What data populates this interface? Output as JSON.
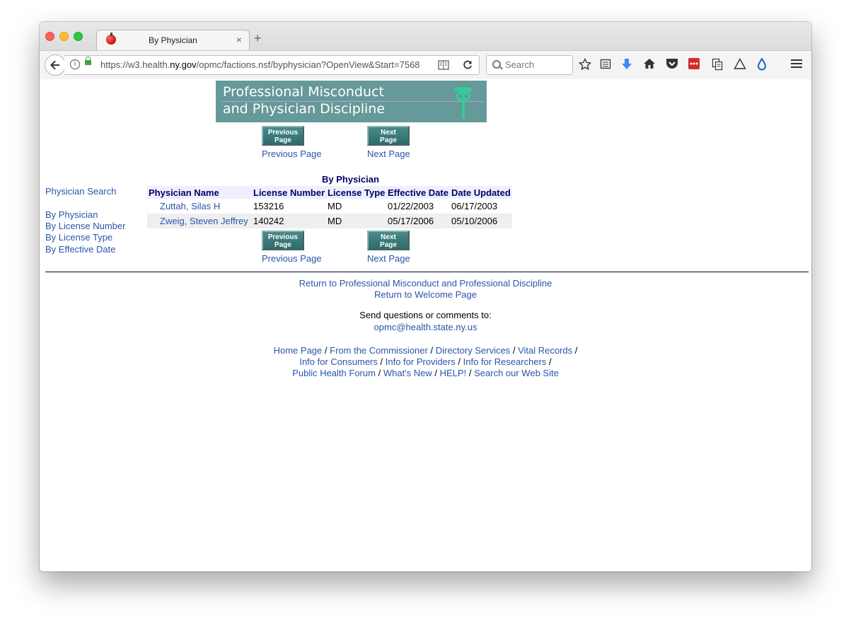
{
  "browser": {
    "tab_title": "By Physician",
    "tab_close": "×",
    "new_tab": "+",
    "url_prefix": "https://w3.health.",
    "url_domain": "ny.gov",
    "url_suffix": "/opmc/factions.nsf/byphysician?OpenView&Start=7568",
    "search_placeholder": "Search",
    "icons": [
      "star-icon",
      "reading-list-icon",
      "download-icon",
      "home-icon",
      "pocket-icon",
      "lastpass-icon",
      "clipboard-icon",
      "delta-icon",
      "drop-icon",
      "menu-icon"
    ]
  },
  "banner": {
    "line1": "Professional Misconduct",
    "line2": "and Physician Discipline"
  },
  "pager": {
    "prev_img_label": "Previous Page",
    "next_img_label": "Next Page",
    "prev_link": "Previous Page",
    "next_link": "Next Page"
  },
  "sidebar": {
    "search": "Physician Search",
    "items": [
      "By Physician",
      "By License Number",
      "By License Type",
      "By Effective Date"
    ]
  },
  "table": {
    "title": "By Physician",
    "columns": [
      "Physician Name",
      "License Number",
      "License Type",
      "Effective Date",
      "Date Updated"
    ],
    "rows": [
      [
        "Zuttah, Silas H",
        "153216",
        "MD",
        "01/22/2003",
        "06/17/2003"
      ],
      [
        "Zweig, Steven Jeffrey",
        "140242",
        "MD",
        "05/17/2006",
        "05/10/2006"
      ]
    ]
  },
  "footer": {
    "return_opmc": "Return to Professional Misconduct and Professional Discipline",
    "return_welcome": "Return to Welcome Page",
    "send_questions": "Send questions or comments to:",
    "email": "opmc@health.state.ny.us",
    "links_line1": [
      "Home Page",
      "From the Commissioner",
      "Directory Services",
      "Vital Records"
    ],
    "links_line2": [
      "Info for Consumers",
      "Info for Providers",
      "Info for Researchers"
    ],
    "links_line3": [
      "Public Health Forum",
      "What's New",
      "HELP!",
      "Search our Web Site"
    ],
    "separator": "/"
  },
  "colors": {
    "link": "#2a55aa",
    "heading": "#000066",
    "banner_bg": "#669999"
  }
}
